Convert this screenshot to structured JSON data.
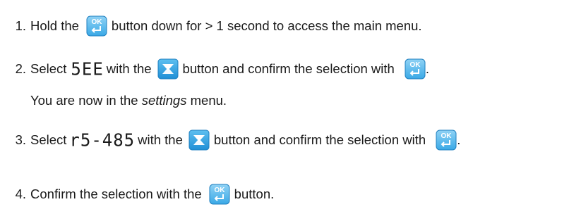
{
  "steps": [
    {
      "number": "1.",
      "text_before": "Hold the",
      "icon_1": "ok-enter-button-icon",
      "text_after": "button down for > 1 second to access the main menu."
    },
    {
      "number": "2.",
      "text_before": "Select",
      "display_code": "5EE",
      "text_mid": "with the",
      "icon_1": "down-arrow-button-icon",
      "text_after": "button and confirm the selection with",
      "icon_2": "ok-enter-button-icon",
      "text_end": ".",
      "note_before": "You are now in the",
      "note_emphasis": "settings",
      "note_after": "menu."
    },
    {
      "number": "3.",
      "text_before": "Select",
      "display_code": "r5-485",
      "text_mid": "with the",
      "icon_1": "down-arrow-button-icon",
      "text_after": "button and confirm the selection with",
      "icon_2": "ok-enter-button-icon",
      "text_end": "."
    },
    {
      "number": "4.",
      "text_before": "Confirm the selection with the",
      "icon_1": "ok-enter-button-icon",
      "text_after": "button."
    }
  ],
  "icon_labels": {
    "ok": "OK"
  },
  "colors": {
    "text": "#1a1a1a",
    "button_blue": "#3aa9e6",
    "button_blue_dark": "#1f7fbf",
    "ok_blue": "#4db3ea"
  }
}
